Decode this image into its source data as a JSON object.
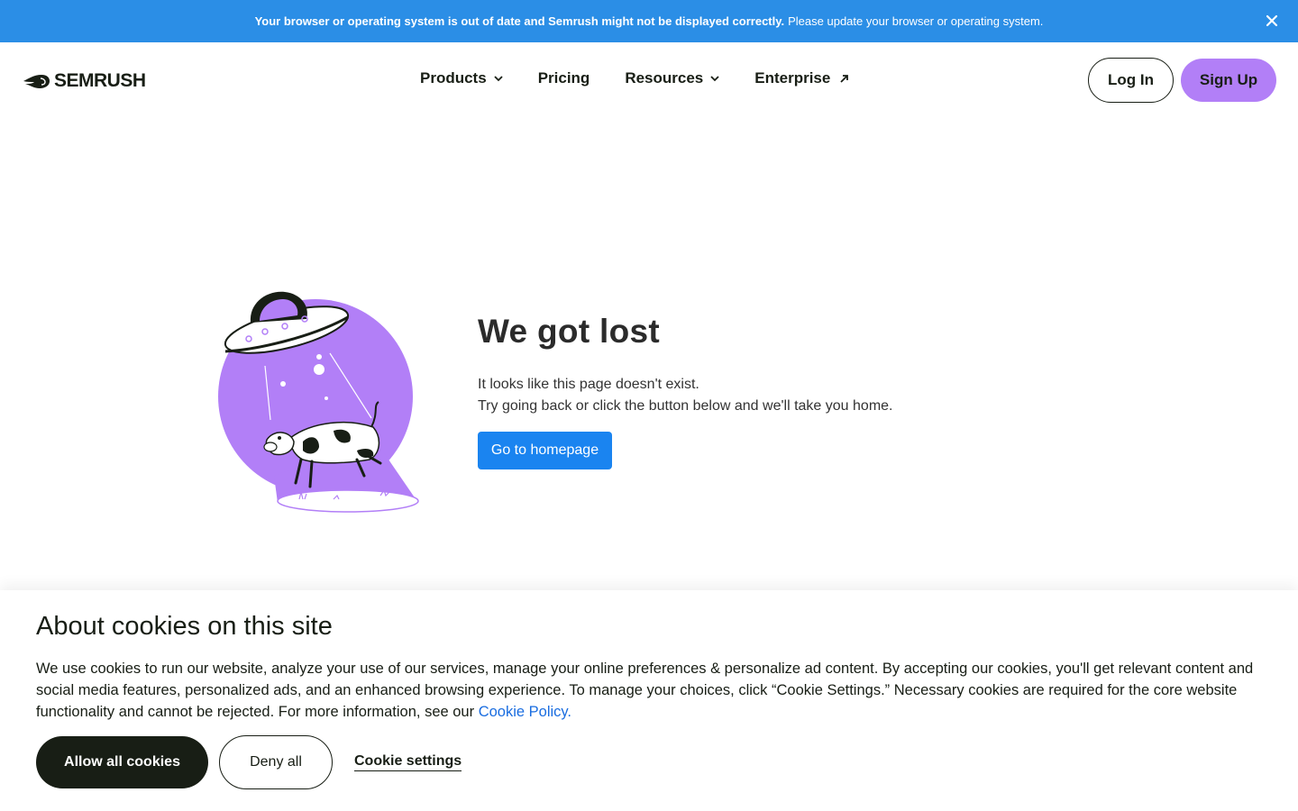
{
  "banner": {
    "bold_text": "Your browser or operating system is out of date and Semrush might not be displayed correctly.",
    "text": "Please update your browser or operating system.",
    "close_icon": "close-icon"
  },
  "header": {
    "logo_text": "SEMRUSH",
    "nav": [
      {
        "label": "Products",
        "icon": "chevron-down-icon"
      },
      {
        "label": "Pricing"
      },
      {
        "label": "Resources",
        "icon": "chevron-down-icon"
      },
      {
        "label": "Enterprise",
        "icon": "external-arrow-icon"
      }
    ],
    "login_label": "Log In",
    "signup_label": "Sign Up"
  },
  "main": {
    "illustration": "ufo-abducting-cow-illustration",
    "title": "We got lost",
    "line1": "It looks like this page doesn't exist.",
    "line2": "Try going back or click the button below and we'll take you home.",
    "button_label": "Go to homepage"
  },
  "cookie_banner": {
    "title": "About cookies on this site",
    "text": "We use cookies to run our website, analyze your use of our services, manage your online preferences & personalize ad content. By accepting our cookies, you'll get relevant content and social media features, personalized ads, and an enhanced browsing experience. To manage your choices, click “Cookie Settings.” Necessary cookies are required for the core website functionality and cannot be rejected. For more information, see our",
    "link_label": "Cookie Policy.",
    "allow_label": "Allow all cookies",
    "deny_label": "Deny all",
    "settings_label": "Cookie settings"
  },
  "colors": {
    "banner": "#2b8ee6",
    "accent_purple": "#b27ff7",
    "primary_blue": "#1a84f0",
    "dark": "#181e15"
  }
}
